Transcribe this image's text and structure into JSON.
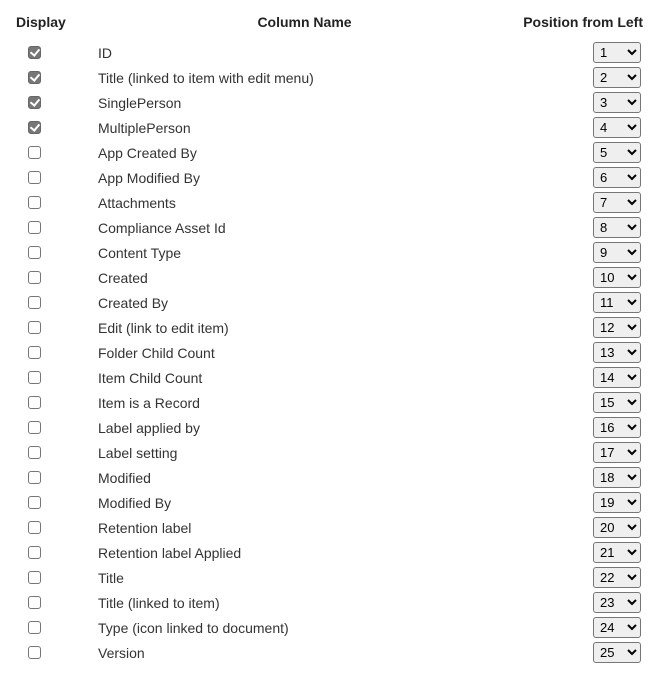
{
  "headers": {
    "display": "Display",
    "column_name": "Column Name",
    "position": "Position from Left"
  },
  "rows": [
    {
      "checked": true,
      "name": "ID",
      "position": "1"
    },
    {
      "checked": true,
      "name": "Title (linked to item with edit menu)",
      "position": "2"
    },
    {
      "checked": true,
      "name": "SinglePerson",
      "position": "3"
    },
    {
      "checked": true,
      "name": "MultiplePerson",
      "position": "4"
    },
    {
      "checked": false,
      "name": "App Created By",
      "position": "5"
    },
    {
      "checked": false,
      "name": "App Modified By",
      "position": "6"
    },
    {
      "checked": false,
      "name": "Attachments",
      "position": "7"
    },
    {
      "checked": false,
      "name": "Compliance Asset Id",
      "position": "8"
    },
    {
      "checked": false,
      "name": "Content Type",
      "position": "9"
    },
    {
      "checked": false,
      "name": "Created",
      "position": "10"
    },
    {
      "checked": false,
      "name": "Created By",
      "position": "11"
    },
    {
      "checked": false,
      "name": "Edit (link to edit item)",
      "position": "12"
    },
    {
      "checked": false,
      "name": "Folder Child Count",
      "position": "13"
    },
    {
      "checked": false,
      "name": "Item Child Count",
      "position": "14"
    },
    {
      "checked": false,
      "name": "Item is a Record",
      "position": "15"
    },
    {
      "checked": false,
      "name": "Label applied by",
      "position": "16"
    },
    {
      "checked": false,
      "name": "Label setting",
      "position": "17"
    },
    {
      "checked": false,
      "name": "Modified",
      "position": "18"
    },
    {
      "checked": false,
      "name": "Modified By",
      "position": "19"
    },
    {
      "checked": false,
      "name": "Retention label",
      "position": "20"
    },
    {
      "checked": false,
      "name": "Retention label Applied",
      "position": "21"
    },
    {
      "checked": false,
      "name": "Title",
      "position": "22"
    },
    {
      "checked": false,
      "name": "Title (linked to item)",
      "position": "23"
    },
    {
      "checked": false,
      "name": "Type (icon linked to document)",
      "position": "24"
    },
    {
      "checked": false,
      "name": "Version",
      "position": "25"
    }
  ]
}
